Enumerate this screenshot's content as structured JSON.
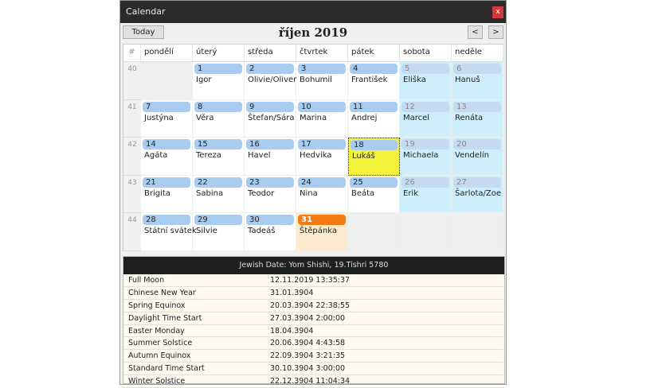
{
  "window": {
    "title": "Calendar",
    "close": "x"
  },
  "toolbar": {
    "today": "Today",
    "month": "říjen 2019",
    "prev": "<",
    "next": ">"
  },
  "grid": {
    "week_header": "#",
    "days": [
      "pondělí",
      "úterý",
      "středa",
      "čtvrtek",
      "pátek",
      "sobota",
      "neděle"
    ],
    "weeks": [
      {
        "no": "40",
        "cells": [
          null,
          {
            "d": "1",
            "n": "Igor"
          },
          {
            "d": "2",
            "n": "Olivie/Oliver"
          },
          {
            "d": "3",
            "n": "Bohumil"
          },
          {
            "d": "4",
            "n": "František"
          },
          {
            "d": "5",
            "n": "Eliška"
          },
          {
            "d": "6",
            "n": "Hanuš"
          }
        ]
      },
      {
        "no": "41",
        "cells": [
          {
            "d": "7",
            "n": "Justýna"
          },
          {
            "d": "8",
            "n": "Věra"
          },
          {
            "d": "9",
            "n": "Štefan/Sára"
          },
          {
            "d": "10",
            "n": "Marina"
          },
          {
            "d": "11",
            "n": "Andrej"
          },
          {
            "d": "12",
            "n": "Marcel"
          },
          {
            "d": "13",
            "n": "Renáta"
          }
        ]
      },
      {
        "no": "42",
        "cells": [
          {
            "d": "14",
            "n": "Agáta"
          },
          {
            "d": "15",
            "n": "Tereza"
          },
          {
            "d": "16",
            "n": "Havel"
          },
          {
            "d": "17",
            "n": "Hedvika"
          },
          {
            "d": "18",
            "n": "Lukáš",
            "selected": true
          },
          {
            "d": "19",
            "n": "Michaela"
          },
          {
            "d": "20",
            "n": "Vendelín"
          }
        ]
      },
      {
        "no": "43",
        "cells": [
          {
            "d": "21",
            "n": "Brigita"
          },
          {
            "d": "22",
            "n": "Sabina"
          },
          {
            "d": "23",
            "n": "Teodor"
          },
          {
            "d": "24",
            "n": "Nina"
          },
          {
            "d": "25",
            "n": "Beáta"
          },
          {
            "d": "26",
            "n": "Erik"
          },
          {
            "d": "27",
            "n": "Šarlota/Zoe"
          }
        ]
      },
      {
        "no": "44",
        "cells": [
          {
            "d": "28",
            "n": "Státní svátek"
          },
          {
            "d": "29",
            "n": "Silvie"
          },
          {
            "d": "30",
            "n": "Tadeáš"
          },
          {
            "d": "31",
            "n": "Štěpánka",
            "holiday": true
          },
          null,
          null,
          null
        ]
      }
    ]
  },
  "info": {
    "header": "Jewish Date: Yom Shishi, 19.Tishri 5780",
    "rows": [
      [
        "Full Moon",
        "12.11.2019 13:35:37"
      ],
      [
        "Chinese New Year",
        "31.01.3904"
      ],
      [
        "Spring Equinox",
        "20.03.3904 22:38:55"
      ],
      [
        "Daylight Time Start",
        "27.03.3904 2:00:00"
      ],
      [
        "Easter Monday",
        "18.04.3904"
      ],
      [
        "Summer Solstice",
        "20.06.3904 4:43:58"
      ],
      [
        "Autumn Equinox",
        "22.09.3904 3:21:35"
      ],
      [
        "Standard Time Start",
        "30.10.3904 3:00:00"
      ],
      [
        "Winter Solstice",
        "22.12.3904 11:04:34"
      ]
    ]
  }
}
